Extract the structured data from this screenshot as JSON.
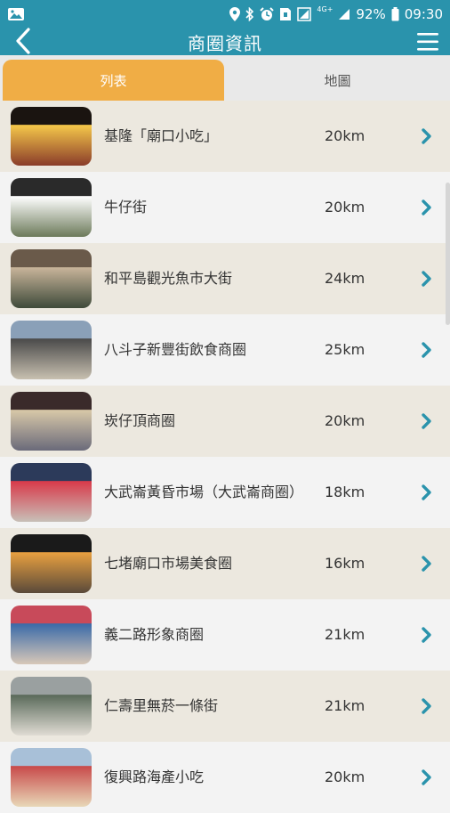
{
  "status": {
    "battery_pct": "92%",
    "time": "09:30",
    "network": "4G+"
  },
  "header": {
    "title": "商圈資訊"
  },
  "tabs": [
    {
      "label": "列表",
      "active": true
    },
    {
      "label": "地圖",
      "active": false
    }
  ],
  "items": [
    {
      "name": "基隆「廟口小吃」",
      "distance": "20km"
    },
    {
      "name": "牛仔街",
      "distance": "20km"
    },
    {
      "name": "和平島觀光魚市大街",
      "distance": "24km"
    },
    {
      "name": "八斗子新豐街飲食商圈",
      "distance": "25km"
    },
    {
      "name": "崁仔頂商圈",
      "distance": "20km"
    },
    {
      "name": "大武崙黃昏市場（大武崙商圈）",
      "distance": "18km"
    },
    {
      "name": "七堵廟口市場美食圈",
      "distance": "16km"
    },
    {
      "name": "義二路形象商圈",
      "distance": "21km"
    },
    {
      "name": "仁壽里無菸一條街",
      "distance": "21km"
    },
    {
      "name": "復興路海產小吃",
      "distance": "20km"
    }
  ],
  "colors": {
    "header": "#2a93ac",
    "tab_active": "#f0ad45",
    "chevron": "#2a93ac"
  }
}
